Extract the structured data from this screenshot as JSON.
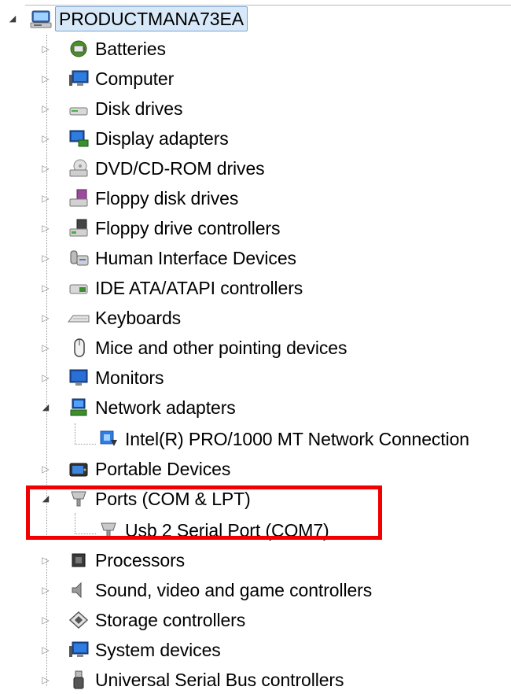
{
  "tree": {
    "root": {
      "label": "PRODUCTMANA73EA",
      "icon": "computer-root-icon",
      "expanded": true
    },
    "categories": [
      {
        "label": "Batteries",
        "icon": "battery-icon",
        "expanded": false
      },
      {
        "label": "Computer",
        "icon": "computer-icon",
        "expanded": false
      },
      {
        "label": "Disk drives",
        "icon": "disk-drive-icon",
        "expanded": false
      },
      {
        "label": "Display adapters",
        "icon": "display-adapter-icon",
        "expanded": false
      },
      {
        "label": "DVD/CD-ROM drives",
        "icon": "dvd-drive-icon",
        "expanded": false
      },
      {
        "label": "Floppy disk drives",
        "icon": "floppy-disk-icon",
        "expanded": false
      },
      {
        "label": "Floppy drive controllers",
        "icon": "floppy-controller-icon",
        "expanded": false
      },
      {
        "label": "Human Interface Devices",
        "icon": "hid-icon",
        "expanded": false
      },
      {
        "label": "IDE ATA/ATAPI controllers",
        "icon": "ide-controller-icon",
        "expanded": false
      },
      {
        "label": "Keyboards",
        "icon": "keyboard-icon",
        "expanded": false
      },
      {
        "label": "Mice and other pointing devices",
        "icon": "mouse-icon",
        "expanded": false
      },
      {
        "label": "Monitors",
        "icon": "monitor-icon",
        "expanded": false
      },
      {
        "label": "Network adapters",
        "icon": "network-adapter-icon",
        "expanded": true,
        "children": [
          {
            "label": "Intel(R) PRO/1000 MT Network Connection",
            "icon": "network-card-icon"
          }
        ]
      },
      {
        "label": "Portable Devices",
        "icon": "portable-device-icon",
        "expanded": false
      },
      {
        "label": "Ports (COM & LPT)",
        "icon": "port-icon",
        "expanded": true,
        "children": [
          {
            "label": "Usb 2 Serial Port (COM7)",
            "icon": "port-icon"
          }
        ]
      },
      {
        "label": "Processors",
        "icon": "processor-icon",
        "expanded": false
      },
      {
        "label": "Sound, video and game controllers",
        "icon": "speaker-icon",
        "expanded": false
      },
      {
        "label": "Storage controllers",
        "icon": "storage-controller-icon",
        "expanded": false
      },
      {
        "label": "System devices",
        "icon": "system-device-icon",
        "expanded": false
      },
      {
        "label": "Universal Serial Bus controllers",
        "icon": "usb-icon",
        "expanded": false
      }
    ]
  },
  "highlight": {
    "color": "#f20000",
    "target": "Ports (COM & LPT)"
  },
  "colors": {
    "root_selection": "#d7e9f9",
    "root_selection_border": "#7da2ce",
    "tree_lines": "#9a9a9a"
  }
}
